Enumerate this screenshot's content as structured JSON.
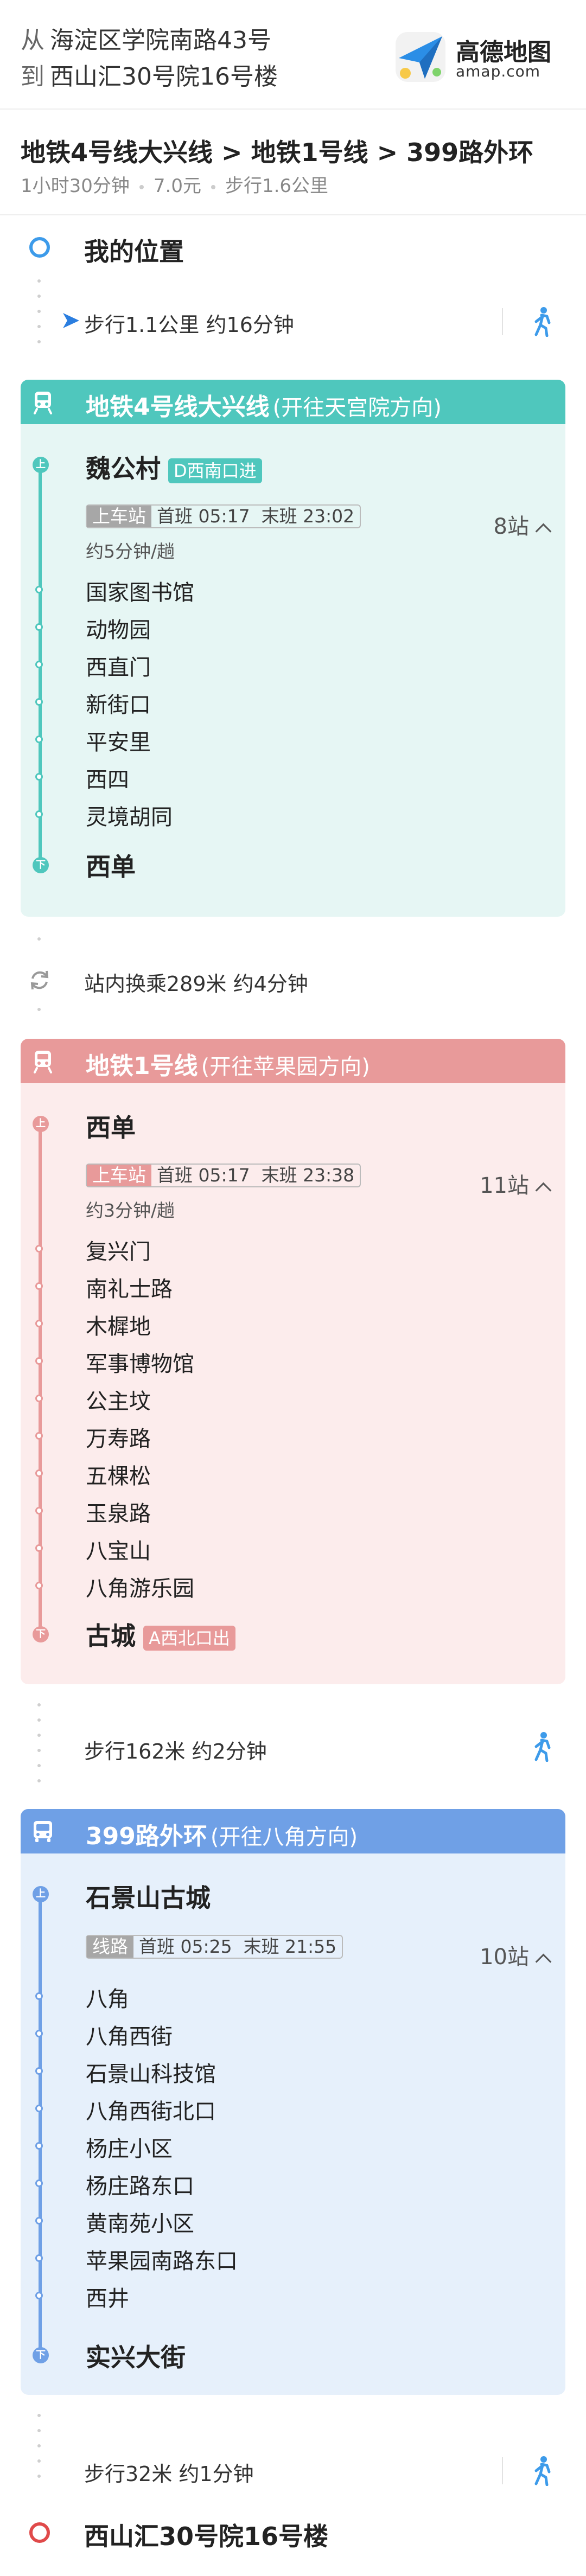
{
  "header": {
    "from_prefix": "从",
    "from": "海淀区学院南路43号",
    "to_prefix": "到",
    "to": "西山汇30号院16号楼",
    "logo_text": "高德地图",
    "logo_sub": "amap.com"
  },
  "summary": {
    "route": "地铁4号线大兴线 > 地铁1号线 > 399路外环",
    "duration": "1小时30分钟",
    "price": "7.0元",
    "walk": "步行1.6公里"
  },
  "start": {
    "label": "我的位置"
  },
  "walk1": {
    "text": "步行1.1公里 约16分钟"
  },
  "seg1": {
    "line": "地铁4号线大兴线",
    "direction": "(开往天宫院方向)",
    "color": "#4fc7bd",
    "board_station": "魏公村",
    "board_exit": "D西南口进",
    "info_label": "上车站",
    "first": "首班 05:17",
    "last": "末班 23:02",
    "freq": "约5分钟/趟",
    "stops_count": "8站",
    "stops": [
      "国家图书馆",
      "动物园",
      "西直门",
      "新街口",
      "平安里",
      "西四",
      "灵境胡同"
    ],
    "alight_station": "西单",
    "cap_up": "上",
    "cap_down": "下"
  },
  "transfer": {
    "text": "站内换乘289米 约4分钟"
  },
  "seg2": {
    "line": "地铁1号线",
    "direction": "(开往苹果园方向)",
    "color": "#e89a9a",
    "board_station": "西单",
    "info_label": "上车站",
    "first": "首班 05:17",
    "last": "末班 23:38",
    "freq": "约3分钟/趟",
    "stops_count": "11站",
    "stops": [
      "复兴门",
      "南礼士路",
      "木樨地",
      "军事博物馆",
      "公主坟",
      "万寿路",
      "五棵松",
      "玉泉路",
      "八宝山",
      "八角游乐园"
    ],
    "alight_station": "古城",
    "alight_exit": "A西北口出",
    "cap_up": "上",
    "cap_down": "下"
  },
  "walk2": {
    "text": "步行162米 约2分钟"
  },
  "seg3": {
    "line": "399路外环",
    "direction": "(开往八角方向)",
    "color": "#6fa0e6",
    "board_station": "石景山古城",
    "info_label": "线路",
    "first": "首班 05:25",
    "last": "末班 21:55",
    "stops_count": "10站",
    "stops": [
      "八角",
      "八角西街",
      "石景山科技馆",
      "八角西街北口",
      "杨庄小区",
      "杨庄路东口",
      "黄南苑小区",
      "苹果园南路东口",
      "西井"
    ],
    "alight_station": "实兴大街",
    "cap_up": "上",
    "cap_down": "下"
  },
  "walk3": {
    "text": "步行32米 约1分钟"
  },
  "end": {
    "label": "西山汇30号院16号楼"
  },
  "icons": {
    "start": "start-ring-icon",
    "end": "end-ring-icon",
    "walk": "walker-icon",
    "subway": "subway-icon",
    "bus": "bus-icon",
    "transfer": "transfer-icon",
    "navigate": "navigation-arrow-icon"
  }
}
